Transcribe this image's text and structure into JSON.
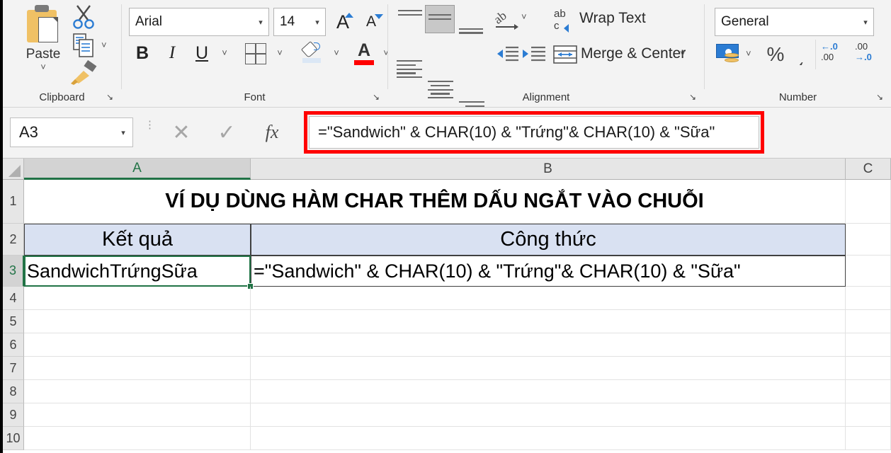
{
  "ribbon": {
    "clipboard": {
      "label": "Clipboard",
      "paste_label": "Paste",
      "paste_caret": "˅",
      "cut_name": "scissors-icon",
      "copy_name": "copy-icon",
      "format_painter_name": "format-painter-icon",
      "dialog_launcher": "↘"
    },
    "font": {
      "label": "Font",
      "font_name": "Arial",
      "font_size": "14",
      "grow_font": "A",
      "shrink_font": "A",
      "bold": "B",
      "italic": "I",
      "underline": "U",
      "caret": "˅",
      "dialog_launcher": "↘"
    },
    "alignment": {
      "label": "Alignment",
      "wrap_text": "Wrap Text",
      "merge_center": "Merge & Center",
      "caret": "˅",
      "dialog_launcher": "↘"
    },
    "number": {
      "label": "Number",
      "format": "General",
      "percent": "%",
      "comma": "͵",
      "increase_decimal_top": "←.0",
      "increase_decimal_bottom": ".00",
      "decrease_decimal_top": ".00",
      "decrease_decimal_bottom": "→.0",
      "caret": "˅",
      "dialog_launcher": "↘"
    }
  },
  "formula_bar": {
    "name_box": "A3",
    "name_box_caret": "▾",
    "cancel_icon": "✕",
    "enter_icon": "✓",
    "function_icon": "fx",
    "formula": "=\"Sandwich\" & CHAR(10) & \"Trứng\"& CHAR(10) & \"Sữa\"",
    "highlight_color": "#FF0000"
  },
  "grid": {
    "columns": [
      {
        "label": "A",
        "selected": true
      },
      {
        "label": "B",
        "selected": false
      },
      {
        "label": "C",
        "selected": false
      }
    ],
    "rows": [
      "1",
      "2",
      "3",
      "4",
      "5",
      "6",
      "7",
      "8",
      "9",
      "10"
    ],
    "selected_row": "3",
    "cells": {
      "a1_title": "VÍ DỤ DÙNG HÀM CHAR THÊM DẤU NGẮT VÀO CHUỖI",
      "a2": "Kết quả",
      "b2": "Công thức",
      "a3": "SandwichTrứngSữa",
      "b3": "=\"Sandwich\" & CHAR(10) & \"Trứng\"& CHAR(10) & \"Sữa\""
    },
    "header_fill_color": "#D9E1F2",
    "selection_color": "#217346"
  }
}
